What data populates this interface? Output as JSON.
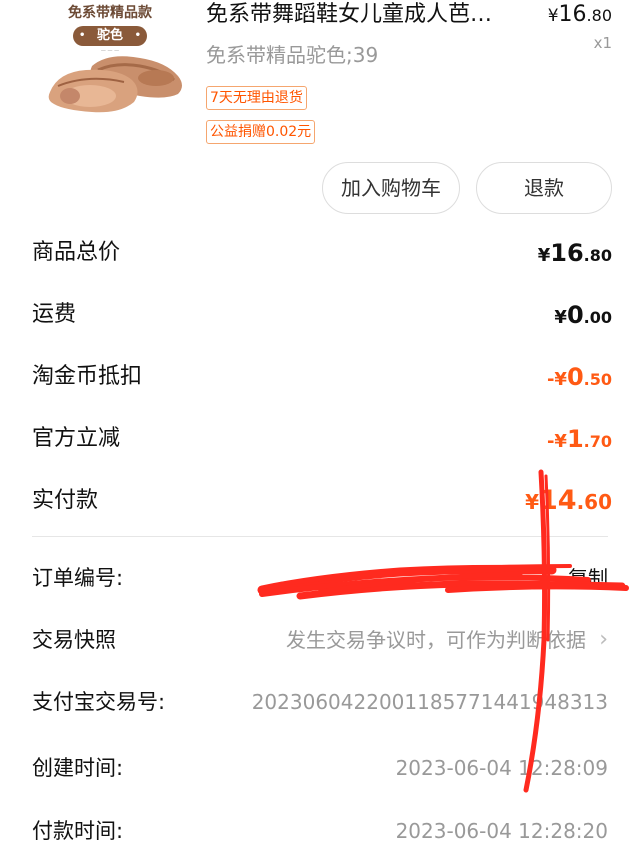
{
  "product": {
    "image": {
      "banner": "免系带精品款",
      "pill": "驼色",
      "pill_sub": "— — —"
    },
    "title": "免系带舞蹈鞋女儿童成人芭…",
    "price": {
      "currency": "¥",
      "integer": "16",
      "decimal": ".80"
    },
    "quantity": "x1",
    "sku": "免系带精品驼色;39",
    "tags": [
      "7天无理由退货",
      "公益捐赠0.02元"
    ],
    "buttons": {
      "add_cart": "加入购物车",
      "refund": "退款"
    }
  },
  "price_rows": [
    {
      "label": "商品总价",
      "currency": "¥",
      "integer": "16",
      "decimal": ".80"
    },
    {
      "label": "运费",
      "currency": "¥",
      "integer": "0",
      "decimal": ".00"
    },
    {
      "label": "淘金币抵扣",
      "currency": "-¥",
      "integer": "0",
      "decimal": ".50"
    },
    {
      "label": "官方立减",
      "currency": "-¥",
      "integer": "1",
      "decimal": ".70"
    },
    {
      "label": "实付款",
      "currency": "¥",
      "integer": "14",
      "decimal": ".60"
    }
  ],
  "order_info": [
    {
      "label": "订单编号:",
      "value": "复制"
    },
    {
      "label": "交易快照",
      "value": "发生交易争议时，可作为判断依据"
    },
    {
      "label": "支付宝交易号:",
      "value": "2023060422001185771441948313"
    },
    {
      "label": "创建时间:",
      "value": "2023-06-04 12:28:09"
    },
    {
      "label": "付款时间:",
      "value": "2023-06-04 12:28:20"
    }
  ],
  "icons": {
    "chevron": "chevron-right-icon"
  },
  "colors": {
    "accent": "#ff5a14",
    "muted": "#999999",
    "scribble": "#ff2020"
  }
}
